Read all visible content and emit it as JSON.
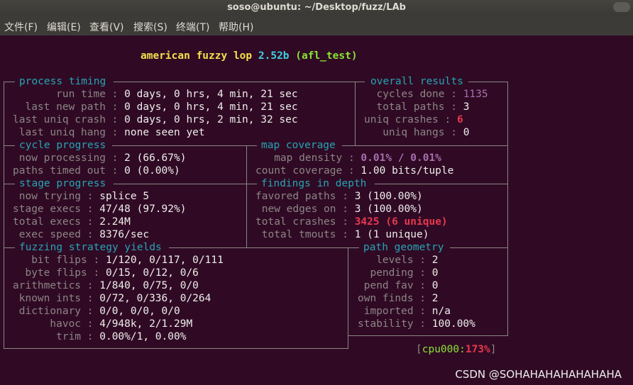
{
  "window": {
    "title": "soso@ubuntu: ~/Desktop/fuzz/LAb",
    "menu": [
      "文件(F)",
      "编辑(E)",
      "查看(V)",
      "搜索(S)",
      "终端(T)",
      "帮助(H)"
    ]
  },
  "banner": {
    "prefix": "american fuzzy lop ",
    "version": "2.52b",
    "target": "(afl_test)"
  },
  "process_timing": {
    "title": "process timing",
    "rows": [
      {
        "label": "       run time",
        "value": "0 days, 0 hrs, 4 min, 21 sec"
      },
      {
        "label": "  last new path",
        "value": "0 days, 0 hrs, 4 min, 21 sec"
      },
      {
        "label": "last uniq crash",
        "value": "0 days, 0 hrs, 2 min, 32 sec"
      },
      {
        "label": " last uniq hang",
        "value": "none seen yet"
      }
    ]
  },
  "overall_results": {
    "title": "overall results",
    "rows": [
      {
        "label": "cycles done",
        "value": "1135"
      },
      {
        "label": "total paths",
        "value": "3"
      },
      {
        "label": "uniq crashes",
        "value": "6"
      },
      {
        "label": " uniq hangs",
        "value": "0"
      }
    ]
  },
  "cycle_progress": {
    "title": "cycle progress",
    "rows": [
      {
        "label": " now processing",
        "value": "2 (66.67%)"
      },
      {
        "label": "paths timed out",
        "value": "0 (0.00%)"
      }
    ]
  },
  "map_coverage": {
    "title": "map coverage",
    "rows": [
      {
        "label": "   map density",
        "value": "0.01% / 0.01%"
      },
      {
        "label": "count coverage",
        "value": "1.00 bits/tuple"
      }
    ]
  },
  "stage_progress": {
    "title": "stage progress",
    "rows": [
      {
        "label": " now trying",
        "value": "splice 5"
      },
      {
        "label": "stage execs",
        "value": "47/48 (97.92%)"
      },
      {
        "label": "total execs",
        "value": "2.24M"
      },
      {
        "label": " exec speed",
        "value": "8376/sec"
      }
    ]
  },
  "findings_in_depth": {
    "title": "findings in depth",
    "rows": [
      {
        "label": "favored paths",
        "value": "3 (100.00%)"
      },
      {
        "label": " new edges on",
        "value": "3 (100.00%)"
      },
      {
        "label": "total crashes",
        "value": "3425 (6 unique)"
      },
      {
        "label": " total tmouts",
        "value": "1 (1 unique)"
      }
    ]
  },
  "fuzzing_strategy_yields": {
    "title": "fuzzing strategy yields",
    "rows": [
      {
        "label": "   bit flips",
        "value": "1/120, 0/117, 0/111"
      },
      {
        "label": "  byte flips",
        "value": "0/15, 0/12, 0/6"
      },
      {
        "label": "arithmetics",
        "value": "1/840, 0/75, 0/0"
      },
      {
        "label": " known ints",
        "value": "0/72, 0/336, 0/264"
      },
      {
        "label": " dictionary",
        "value": "0/0, 0/0, 0/0"
      },
      {
        "label": "      havoc",
        "value": "4/948k, 2/1.29M"
      },
      {
        "label": "       trim",
        "value": "0.00%/1, 0.00%"
      }
    ]
  },
  "path_geometry": {
    "title": "path geometry",
    "rows": [
      {
        "label": "   levels",
        "value": "2"
      },
      {
        "label": "  pending",
        "value": "0"
      },
      {
        "label": " pend fav",
        "value": "0"
      },
      {
        "label": "own finds",
        "value": "2"
      },
      {
        "label": " imported",
        "value": "n/a"
      },
      {
        "label": "stability",
        "value": "100.00%"
      }
    ]
  },
  "cpu": {
    "open": "[",
    "name": "cpu000:",
    "value": "173%",
    "close": "]"
  },
  "watermark": "CSDN @SOHAHAHAHAHAHAHA",
  "colors": {
    "background": "#300a24",
    "section_title": "#26a4b5",
    "label": "#8c8585",
    "value": "#eeeeec",
    "crash_red": "#e8384f",
    "cycles_purple": "#a66fae"
  }
}
